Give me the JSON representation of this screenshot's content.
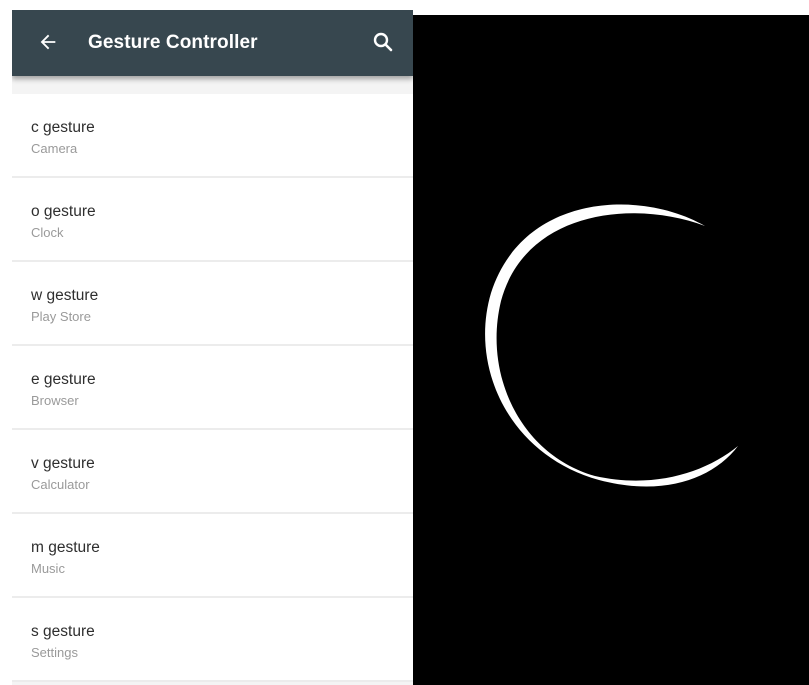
{
  "app_bar": {
    "title": "Gesture Controller",
    "back_icon": "arrow-back-icon",
    "search_icon": "search-icon",
    "color": "#37474f"
  },
  "gestures": [
    {
      "title": "c gesture",
      "subtitle": "Camera"
    },
    {
      "title": "o gesture",
      "subtitle": "Clock"
    },
    {
      "title": "w gesture",
      "subtitle": "Play Store"
    },
    {
      "title": "e gesture",
      "subtitle": "Browser"
    },
    {
      "title": "v gesture",
      "subtitle": "Calculator"
    },
    {
      "title": "m gesture",
      "subtitle": "Music"
    },
    {
      "title": "s gesture",
      "subtitle": "Settings"
    }
  ],
  "preview": {
    "background": "#000000",
    "stroke_color": "#ffffff",
    "shape": "c-gesture-stroke"
  }
}
